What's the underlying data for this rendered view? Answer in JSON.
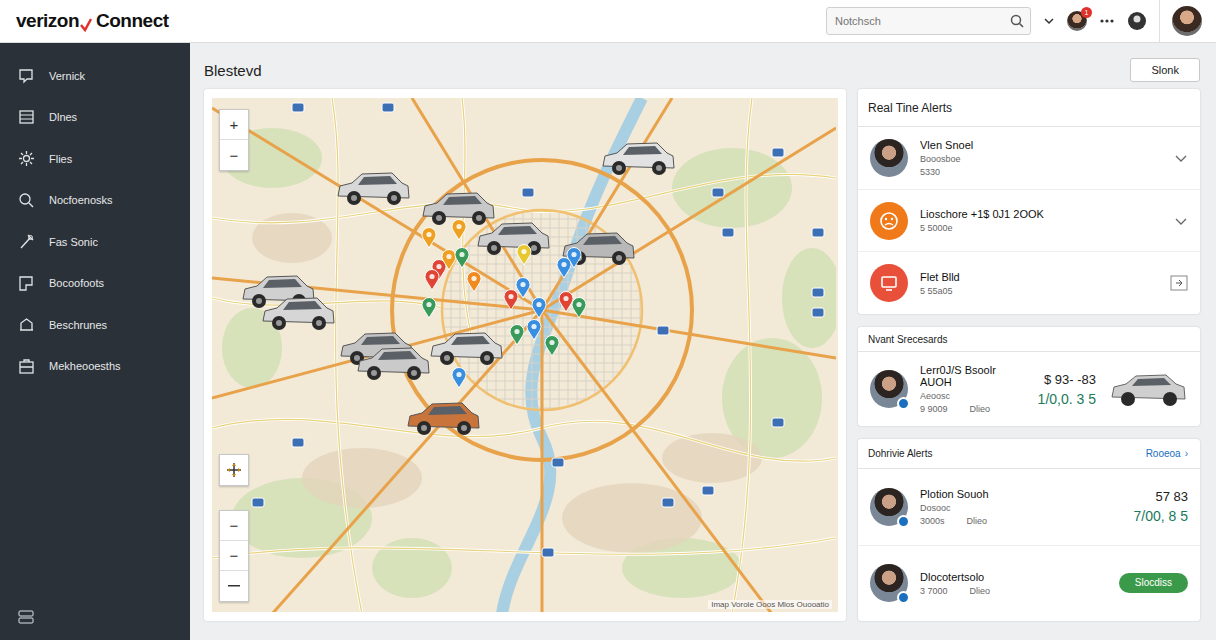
{
  "header": {
    "logo": "verizon",
    "logo_suffix": "Connect",
    "search": {
      "placeholder": "Notchsch"
    },
    "badge": "1"
  },
  "sidebar": {
    "items": [
      {
        "label": "Vernick",
        "selected": false
      },
      {
        "label": "Dlnes",
        "selected": false
      },
      {
        "label": "Flies",
        "selected": false
      },
      {
        "label": "Nocfoenosks",
        "selected": false
      },
      {
        "label": "Fas Sonic",
        "selected": false
      },
      {
        "label": "Bocoofoots",
        "selected": false
      },
      {
        "label": "Beschrunes",
        "selected": false
      },
      {
        "label": "Mekheooesths",
        "selected": false
      }
    ]
  },
  "page": {
    "title": "Blestevd",
    "action": "Slonk"
  },
  "map": {
    "zoom_in": "+",
    "zoom_out": "−",
    "lower_controls": [
      "−",
      "−"
    ],
    "attribution": "Imap Vorole Ooos Mlos Ouooatio",
    "pins": [
      {
        "color": "#f0a020"
      },
      {
        "color": "#f0a020"
      },
      {
        "color": "#e04434"
      },
      {
        "color": "#f0a020"
      },
      {
        "color": "#3a9a5a"
      },
      {
        "color": "#f08a20"
      },
      {
        "color": "#e04434"
      },
      {
        "color": "#e8c830"
      },
      {
        "color": "#3a8ee0"
      },
      {
        "color": "#3a8ee0"
      },
      {
        "color": "#3a8ee0"
      },
      {
        "color": "#e04434"
      },
      {
        "color": "#3a8ee0"
      },
      {
        "color": "#e04434"
      },
      {
        "color": "#3a9a5a"
      },
      {
        "color": "#3a9a5a"
      },
      {
        "color": "#3a9a5a"
      },
      {
        "color": "#3a9a5a"
      },
      {
        "color": "#3a8ee0"
      },
      {
        "color": "#3a8ee0"
      }
    ],
    "cars": [
      {
        "color": "#d8d8d8"
      },
      {
        "color": "#c8c8c8"
      },
      {
        "color": "#cfcfcf"
      },
      {
        "color": "#b8b8b8"
      },
      {
        "color": "#e2e2e2"
      },
      {
        "color": "#d0d0d0"
      },
      {
        "color": "#d6d6d6"
      },
      {
        "color": "#c4c4c4"
      },
      {
        "color": "#cacaca"
      },
      {
        "color": "#dadada"
      },
      {
        "color": "#c8743a"
      }
    ]
  },
  "real_time_alerts": {
    "title": "Real Tine Alerts",
    "items": [
      {
        "kind": "photo",
        "title": "Vlen Snoel",
        "subtitle": "Booosboe",
        "meta": "5330",
        "action": "chevron"
      },
      {
        "kind": "warning",
        "title": "Lioschore +1$ 0J1 2OOK",
        "subtitle": "",
        "meta": "5 5000e",
        "action": "chevron"
      },
      {
        "kind": "alert",
        "title": "Flet Blld",
        "subtitle": "",
        "meta": "5 55a05",
        "action": "box"
      }
    ]
  },
  "recent": {
    "title": "Nvant Srecesards",
    "items": [
      {
        "title": "Lerr0J/S Bsoolr AUOH",
        "subtitle": "Aeoosc",
        "meta": [
          "9 9009",
          "Dlieo"
        ],
        "value": "$ 93- -83",
        "amount": "1/0,0. 3 5"
      }
    ]
  },
  "driver_alerts": {
    "title": "Dohrivie Alerts",
    "link": "Rooeoa",
    "link_icon": "›",
    "items": [
      {
        "title": "Plotion Souoh",
        "subtitle": "Dosooc",
        "meta": [
          "3000s",
          "Dlieo"
        ],
        "value": "57 83",
        "amount": "7/00, 8 5",
        "button": ""
      },
      {
        "title": "Dlocotertsolo",
        "subtitle": "",
        "meta": [
          "3 7000",
          "Dlieo"
        ],
        "value": "",
        "amount": "",
        "button": "Slocdiss"
      }
    ]
  }
}
